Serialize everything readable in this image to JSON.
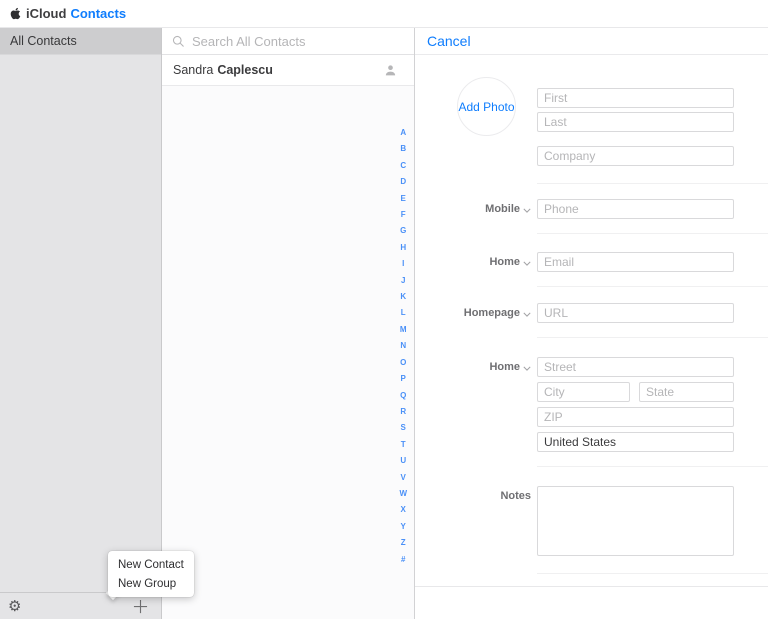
{
  "topbar": {
    "brand": "iCloud",
    "app": "Contacts"
  },
  "sidebar": {
    "items": [
      {
        "label": "All Contacts"
      }
    ],
    "new_menu": {
      "items": [
        {
          "label": "New Contact"
        },
        {
          "label": "New Group"
        }
      ]
    }
  },
  "contacts": {
    "search_placeholder": "Search All Contacts",
    "list": [
      {
        "first": "Sandra",
        "last": "Caplescu"
      }
    ],
    "alphabet": [
      "A",
      "B",
      "C",
      "D",
      "E",
      "F",
      "G",
      "H",
      "I",
      "J",
      "K",
      "L",
      "M",
      "N",
      "O",
      "P",
      "Q",
      "R",
      "S",
      "T",
      "U",
      "V",
      "W",
      "X",
      "Y",
      "Z",
      "#"
    ]
  },
  "form": {
    "cancel": "Cancel",
    "add_photo": "Add Photo",
    "first_ph": "First",
    "last_ph": "Last",
    "company_ph": "Company",
    "phone": {
      "label": "Mobile",
      "ph": "Phone"
    },
    "email": {
      "label": "Home",
      "ph": "Email"
    },
    "homepage": {
      "label": "Homepage",
      "ph": "URL"
    },
    "address": {
      "label": "Home",
      "street_ph": "Street",
      "city_ph": "City",
      "state_ph": "State",
      "zip_ph": "ZIP",
      "country": "United States"
    },
    "notes_label": "Notes"
  },
  "colors": {
    "accent": "#0f7dfd",
    "alphabet_blue": "#4a90f7",
    "sidebar_gray": "#e4e4e6",
    "selected_gray": "#cdcdcf"
  }
}
